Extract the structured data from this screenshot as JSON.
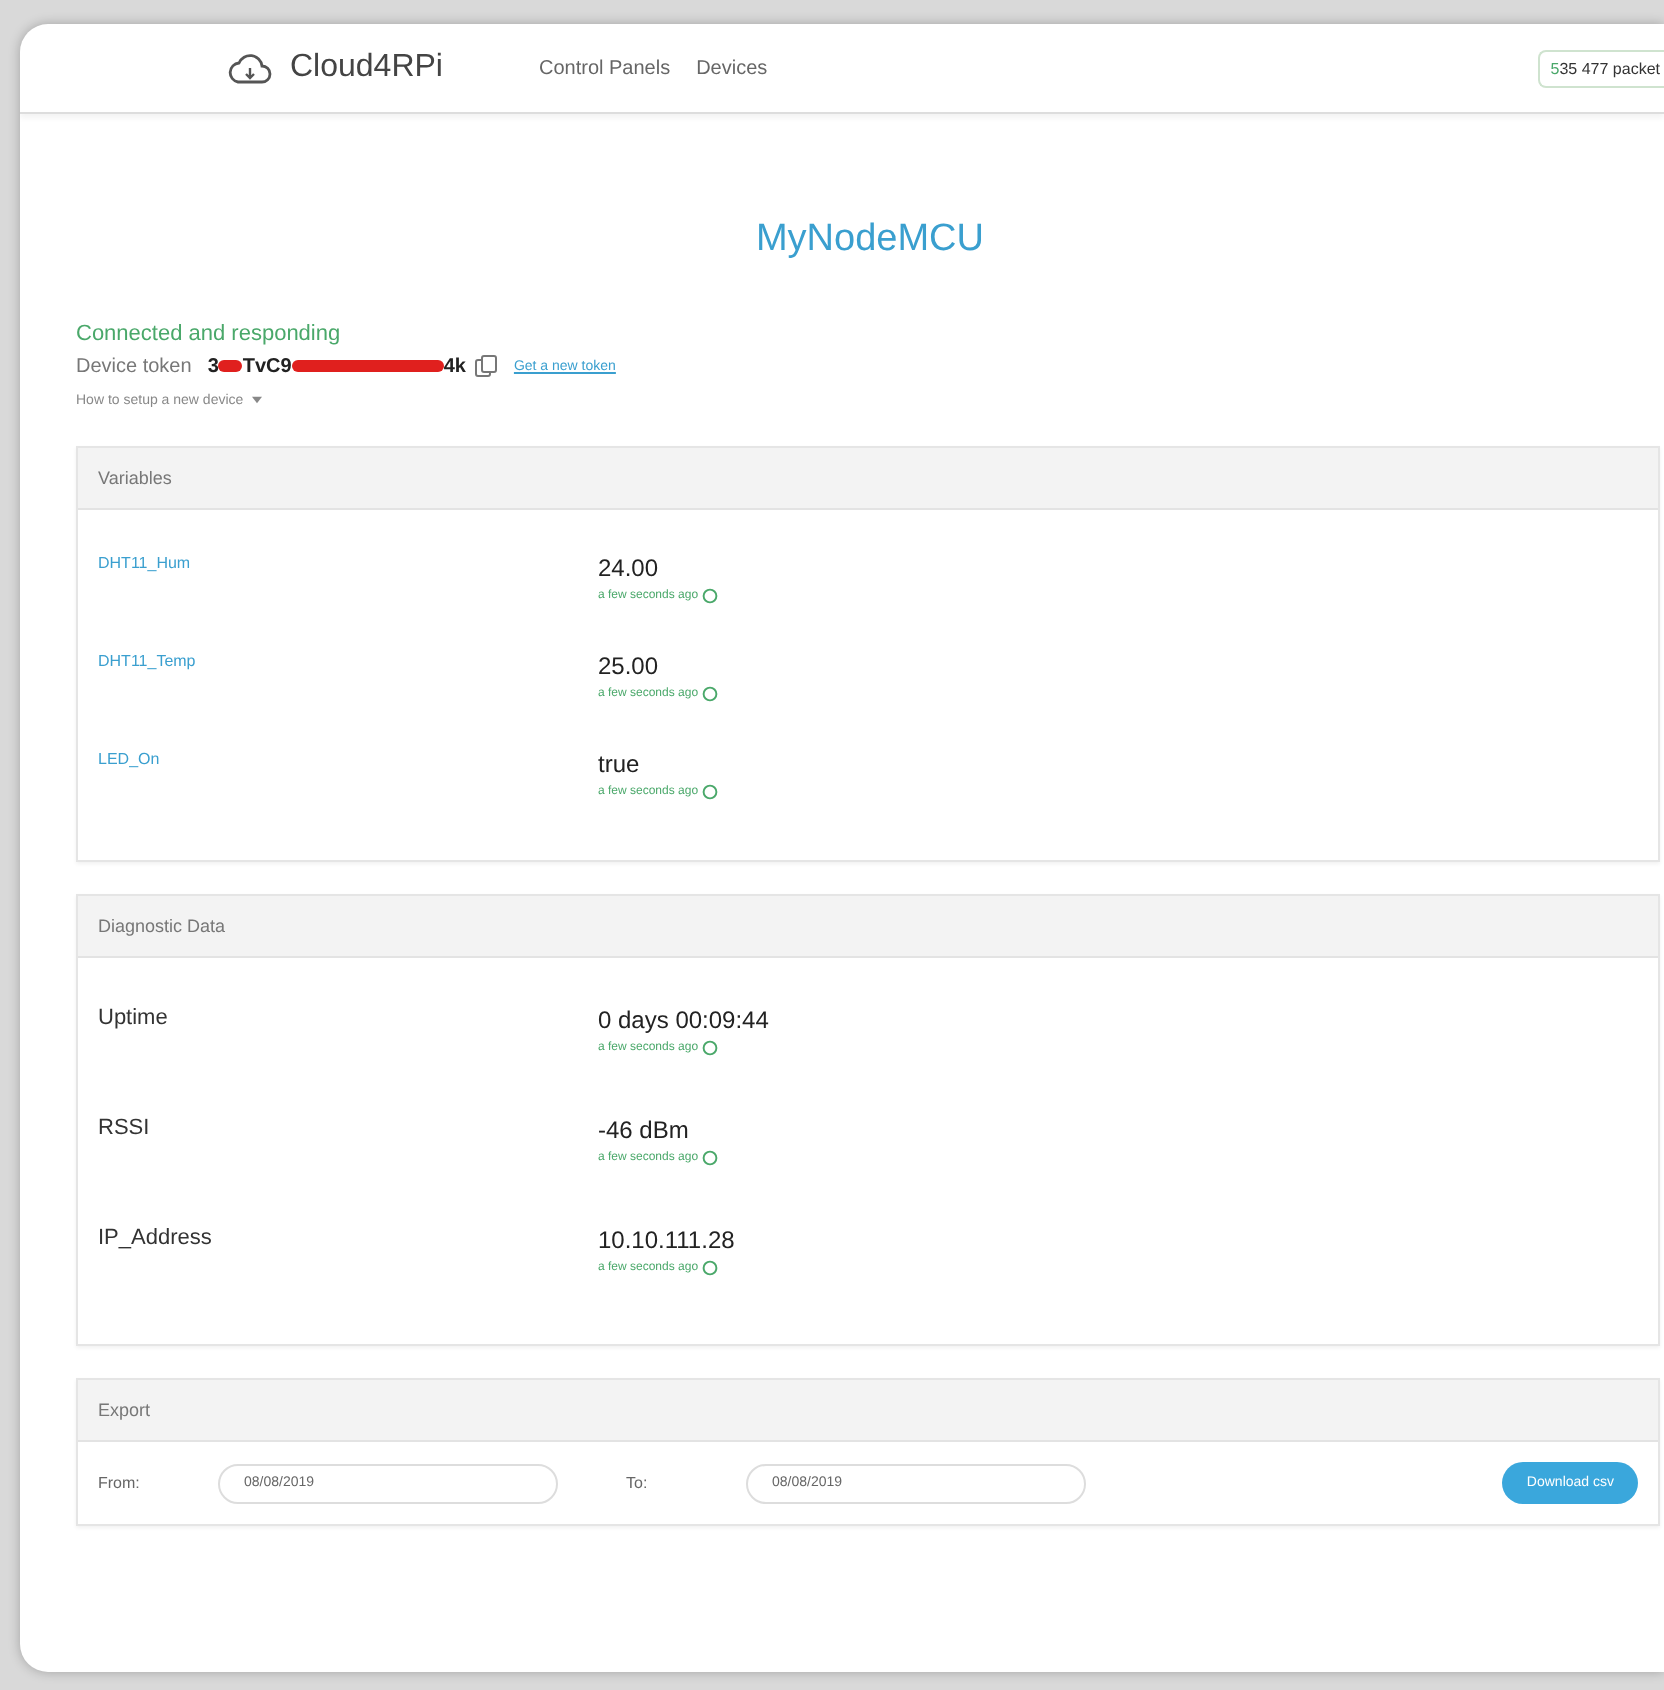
{
  "header": {
    "logo": "Cloud4RPi",
    "nav": [
      {
        "label": "Control Panels"
      },
      {
        "label": "Devices"
      }
    ],
    "packets": "535 477 packet"
  },
  "device": {
    "name": "MyNodeMCU",
    "status": "Connected and responding",
    "token_label": "Device token",
    "token_parts": [
      "3",
      "TvC9",
      "4k"
    ],
    "new_token_link": "Get a new token",
    "setup_link": "How to setup a new device"
  },
  "variables": {
    "title": "Variables",
    "rows": [
      {
        "name": "DHT11_Hum",
        "value": "24.00",
        "time": "a few seconds ago"
      },
      {
        "name": "DHT11_Temp",
        "value": "25.00",
        "time": "a few seconds ago"
      },
      {
        "name": "LED_On",
        "value": "true",
        "time": "a few seconds ago"
      }
    ]
  },
  "diagnostics": {
    "title": "Diagnostic Data",
    "rows": [
      {
        "name": "Uptime",
        "value": "0 days 00:09:44",
        "time": "a few seconds ago"
      },
      {
        "name": "RSSI",
        "value": "-46 dBm",
        "time": "a few seconds ago"
      },
      {
        "name": "IP_Address",
        "value": "10.10.111.28",
        "time": "a few seconds ago"
      }
    ]
  },
  "export": {
    "title": "Export",
    "from_label": "From:",
    "from_value": "08/08/2019",
    "to_label": "To:",
    "to_value": "08/08/2019",
    "button": "Download csv"
  }
}
